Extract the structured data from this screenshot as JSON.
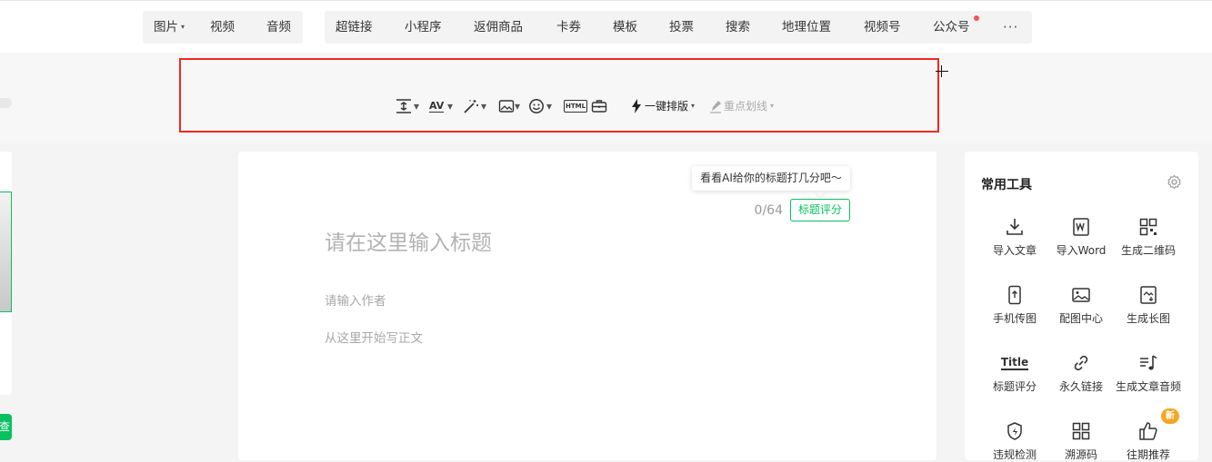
{
  "media_tabs": [
    {
      "label": "图片",
      "caret": "▾"
    },
    {
      "label": "视频"
    },
    {
      "label": "音频"
    }
  ],
  "insert_tabs": [
    {
      "label": "超链接"
    },
    {
      "label": "小程序"
    },
    {
      "label": "返佣商品"
    },
    {
      "label": "卡券"
    },
    {
      "label": "模板"
    },
    {
      "label": "投票"
    },
    {
      "label": "搜索"
    },
    {
      "label": "地理位置"
    },
    {
      "label": "视频号"
    },
    {
      "label": "公众号"
    }
  ],
  "more_label": "···",
  "format_toolbar": {
    "caret": "▾",
    "html_label": "HTML",
    "ai_layout_label": "一键排版",
    "highlight_label": "重点划线",
    "av_label": "AV"
  },
  "left_panel": {
    "button_text": "查"
  },
  "editor": {
    "tooltip": "看看AI给你的标题打几分吧～",
    "counter": "0/64",
    "score_button": "标题评分",
    "title_placeholder": "请在这里输入标题",
    "author_placeholder": "请输入作者",
    "body_placeholder": "从这里开始写正文"
  },
  "tools_panel": {
    "title": "常用工具",
    "badge": "新",
    "tools": [
      {
        "label": "导入文章",
        "icon": "import-icon"
      },
      {
        "label": "导入Word",
        "icon": "word-icon"
      },
      {
        "label": "生成二维码",
        "icon": "qrcode-icon"
      },
      {
        "label": "手机传图",
        "icon": "phone-upload-icon"
      },
      {
        "label": "配图中心",
        "icon": "image-center-icon"
      },
      {
        "label": "生成长图",
        "icon": "long-image-icon"
      },
      {
        "label": "标题评分",
        "icon": "title-score-icon",
        "glyph": "Title"
      },
      {
        "label": "永久链接",
        "icon": "link-icon"
      },
      {
        "label": "生成文章音频",
        "icon": "audio-icon"
      },
      {
        "label": "违规检测",
        "icon": "shield-icon"
      },
      {
        "label": "溯源码",
        "icon": "trace-code-icon"
      },
      {
        "label": "往期推荐",
        "icon": "thumbs-up-icon"
      }
    ]
  },
  "colors": {
    "accent": "#07c160",
    "selection": "#ee2a24",
    "badge": "#f5a623",
    "dot": "#fa5151"
  }
}
